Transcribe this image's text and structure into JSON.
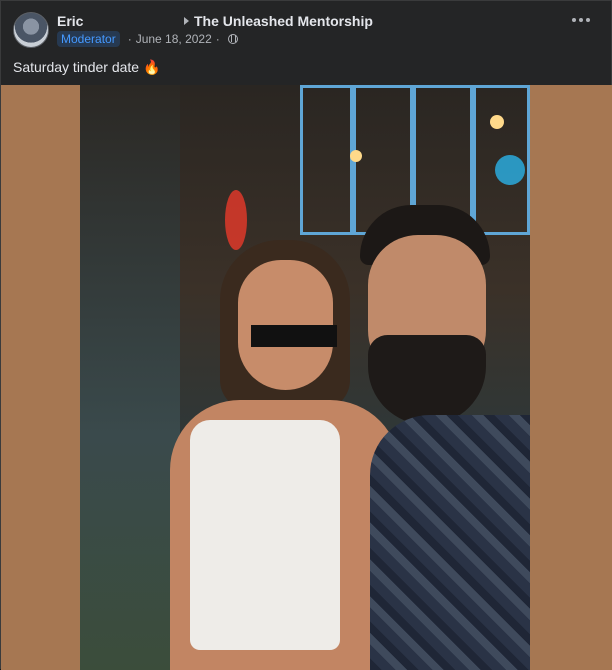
{
  "post": {
    "author": "Eric",
    "group_name": "The Unleashed Mentorship",
    "role_badge": "Moderator",
    "date": "June 18, 2022",
    "separator": "·",
    "audience_icon": "globe-icon",
    "more_icon": "more-options-icon",
    "text": "Saturday tinder date",
    "emoji": "🔥"
  },
  "colors": {
    "background": "#242526",
    "badge_bg": "#263951",
    "badge_text": "#4599ff",
    "media_frame": "#a67752"
  }
}
